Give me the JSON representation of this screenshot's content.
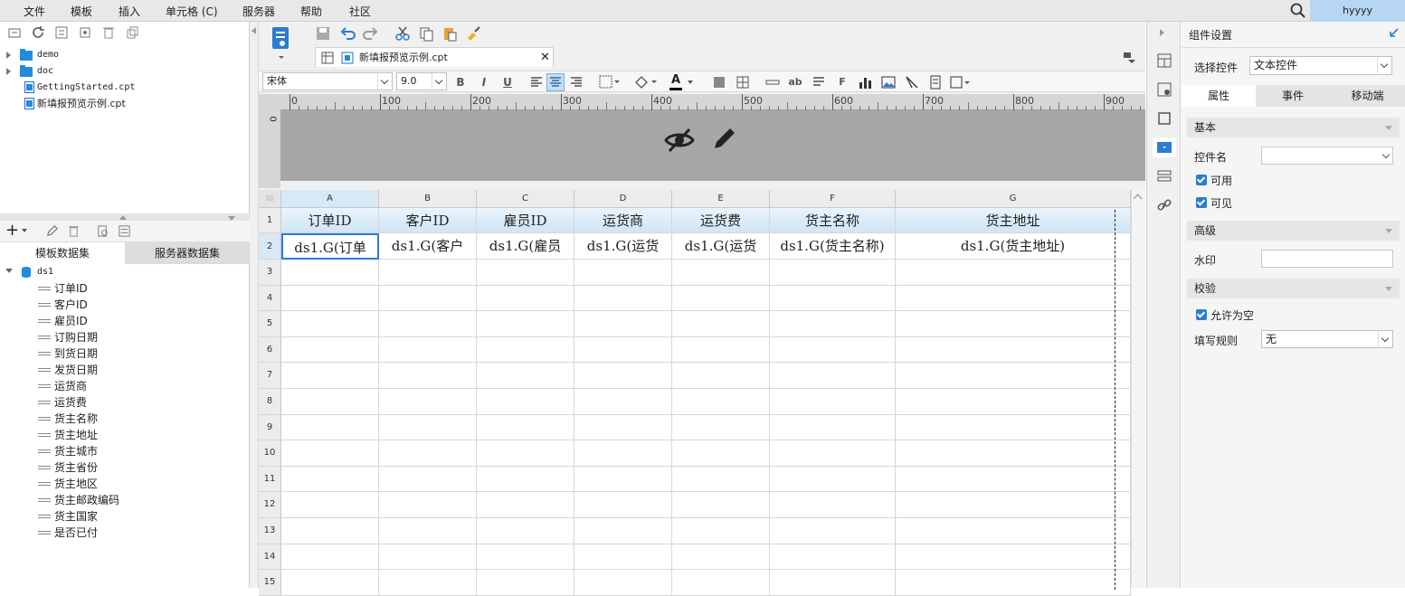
{
  "menubar": {
    "items": [
      "文件",
      "模板",
      "插入",
      "单元格 (C)",
      "服务器",
      "帮助",
      "社区"
    ],
    "user": "hyyyy"
  },
  "left": {
    "tree": [
      {
        "label": "demo",
        "type": "folder"
      },
      {
        "label": "doc",
        "type": "folder"
      },
      {
        "label": "GettingStarted.cpt",
        "type": "file"
      },
      {
        "label": "新填报预览示例.cpt",
        "type": "file"
      }
    ],
    "tabs": [
      "模板数据集",
      "服务器数据集"
    ],
    "dataset": {
      "name": "ds1",
      "fields": [
        "订单ID",
        "客户ID",
        "雇员ID",
        "订购日期",
        "到货日期",
        "发货日期",
        "运货商",
        "运货费",
        "货主名称",
        "货主地址",
        "货主城市",
        "货主省份",
        "货主地区",
        "货主邮政编码",
        "货主国家",
        "是否已付"
      ]
    }
  },
  "editor": {
    "file_tab": "新填报预览示例.cpt",
    "font_name": "宋体",
    "font_size": "9.0",
    "ruler_ticks": [
      "0",
      "100",
      "200",
      "300",
      "400",
      "500",
      "600",
      "700",
      "800",
      "900"
    ],
    "vruler_label": "0",
    "columns": [
      "A",
      "B",
      "C",
      "D",
      "E",
      "F",
      "G"
    ],
    "rows": [
      "1",
      "2",
      "3",
      "4",
      "5",
      "6",
      "7",
      "8",
      "9",
      "10",
      "11",
      "12",
      "13",
      "14",
      "15"
    ],
    "header_cells": [
      "订单ID",
      "客户ID",
      "雇员ID",
      "运货商",
      "运货费",
      "货主名称",
      "货主地址"
    ],
    "data_cells": [
      "ds1.G(订单",
      "ds1.G(客户",
      "ds1.G(雇员",
      "ds1.G(运货",
      "ds1.G(运货",
      "ds1.G(货主名称)",
      "ds1.G(货主地址)"
    ]
  },
  "rpanel": {
    "title": "组件设置",
    "select_label": "选择控件",
    "select_value": "文本控件",
    "tabs": [
      "属性",
      "事件",
      "移动端"
    ],
    "sections": {
      "basic": "基本",
      "advanced": "高级",
      "validate": "校验"
    },
    "control_name_label": "控件名",
    "enabled_label": "可用",
    "visible_label": "可见",
    "watermark_label": "水印",
    "allow_empty_label": "允许为空",
    "rule_label": "填写规则",
    "rule_value": "无"
  },
  "colors": {
    "accent": "#2b7cd3",
    "header_fill": "#cfe5f7",
    "user_bg": "#b6d6f2"
  }
}
